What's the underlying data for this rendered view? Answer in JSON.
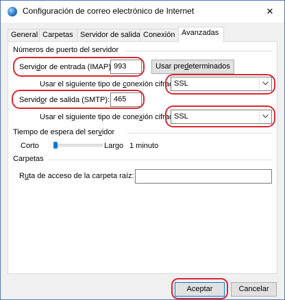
{
  "window": {
    "title": "Configuración de correo electrónico de Internet",
    "close_symbol": "✕"
  },
  "tabs": [
    {
      "label": "General",
      "active": false
    },
    {
      "label": "Carpetas",
      "active": false
    },
    {
      "label": "Servidor de salida",
      "active": false
    },
    {
      "label": "Conexión",
      "active": false
    },
    {
      "label": "Avanzadas",
      "active": true
    }
  ],
  "ports_group": {
    "heading": "Números de puerto del servidor",
    "incoming_label_pre": "Servi",
    "incoming_label_key": "d",
    "incoming_label_post": "or de entrada (IMAP):",
    "incoming_value": "993",
    "defaults_button_pre": "Usar pre",
    "defaults_button_key": "d",
    "defaults_button_post": "eterminados",
    "incoming_encryption_label_pre": "Usar el siguiente tipo de ",
    "incoming_encryption_label_key": "c",
    "incoming_encryption_label_post": "onexión cifrada:",
    "incoming_encryption_value": "SSL",
    "outgoing_label_pre": "Servid",
    "outgoing_label_key": "o",
    "outgoing_label_post": "r de salida (SMTP):",
    "outgoing_value": "465",
    "outgoing_encryption_label_pre": "Usar el siguiente tipo de cone",
    "outgoing_encryption_label_key": "x",
    "outgoing_encryption_label_post": "ión cifrada:",
    "outgoing_encryption_value": "SSL"
  },
  "timeout_group": {
    "heading_pre": "Tiempo de espera del ser",
    "heading_key": "v",
    "heading_post": "idor",
    "short_label": "Corto",
    "long_label": "Largo",
    "timeout_value": "1 minuto"
  },
  "folders_group": {
    "heading": "Carpetas",
    "root_path_label_pre": "R",
    "root_path_label_key": "u",
    "root_path_label_post": "ta de acceso de la carpeta raíz:",
    "root_path_value": ""
  },
  "footer": {
    "accept_label": "Aceptar",
    "cancel_label": "Cancelar"
  },
  "colors": {
    "highlight": "#d9262e",
    "accent": "#0078d7"
  },
  "icons": {
    "app": "outlook-globe-icon",
    "close": "close-icon",
    "dropdown": "chevron-down-icon"
  }
}
